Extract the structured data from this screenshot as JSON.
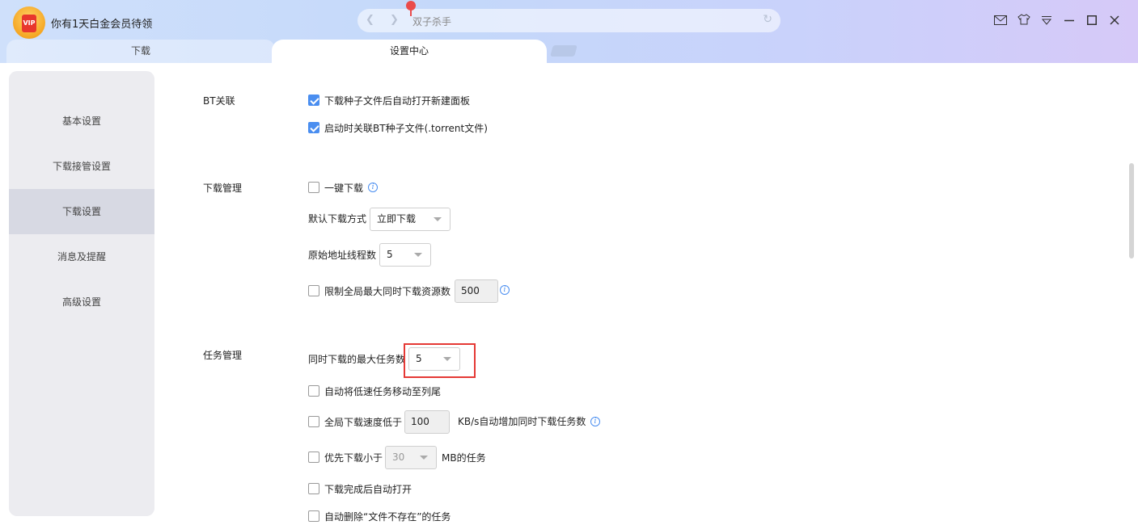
{
  "header": {
    "vip_badge": "VIP",
    "vip_title": "你有1天白金会员待领",
    "address": "双子杀手"
  },
  "icons": [
    "back-icon",
    "forward-icon",
    "location-pin-icon",
    "refresh-icon",
    "mail-icon",
    "skin-icon",
    "menu-icon",
    "minimize-icon",
    "maximize-icon",
    "close-icon"
  ],
  "tabs": [
    {
      "label": "下载"
    },
    {
      "label": "设置中心"
    }
  ],
  "sidebar": {
    "items": [
      {
        "label": "基本设置"
      },
      {
        "label": "下载接管设置"
      },
      {
        "label": "下载设置"
      },
      {
        "label": "消息及提醒"
      },
      {
        "label": "高级设置"
      }
    ],
    "active_index": 2
  },
  "bt": {
    "label": "BT关联",
    "opt1": {
      "label": "下载种子文件后自动打开新建面板",
      "checked": true
    },
    "opt2": {
      "label": "启动时关联BT种子文件(.torrent文件)",
      "checked": true
    }
  },
  "download_mgmt": {
    "label": "下载管理",
    "one_click": {
      "label": "一键下载",
      "checked": false
    },
    "default_mode_label": "默认下载方式",
    "default_mode_value": "立即下载",
    "threads_label": "原始地址线程数",
    "threads_value": "5",
    "limit_resources": {
      "label": "限制全局最大同时下载资源数",
      "checked": false,
      "value": "500"
    }
  },
  "task_mgmt": {
    "label": "任务管理",
    "max_tasks_label": "同时下载的最大任务数",
    "max_tasks_value": "5",
    "move_slow": {
      "label": "自动将低速任务移动至列尾",
      "checked": false
    },
    "speed_low": {
      "label": "全局下载速度低于",
      "value": "100",
      "suffix": "KB/s自动增加同时下载任务数",
      "checked": false
    },
    "prefer_small": {
      "label": "优先下载小于",
      "value": "30",
      "suffix": "MB的任务",
      "checked": false
    },
    "auto_open": {
      "label": "下载完成后自动打开",
      "checked": false
    },
    "auto_delete": {
      "label": "自动删除“文件不存在”的任务",
      "checked": false
    }
  },
  "colors": {
    "accent": "#4a8ef0",
    "highlight": "#e53935"
  }
}
